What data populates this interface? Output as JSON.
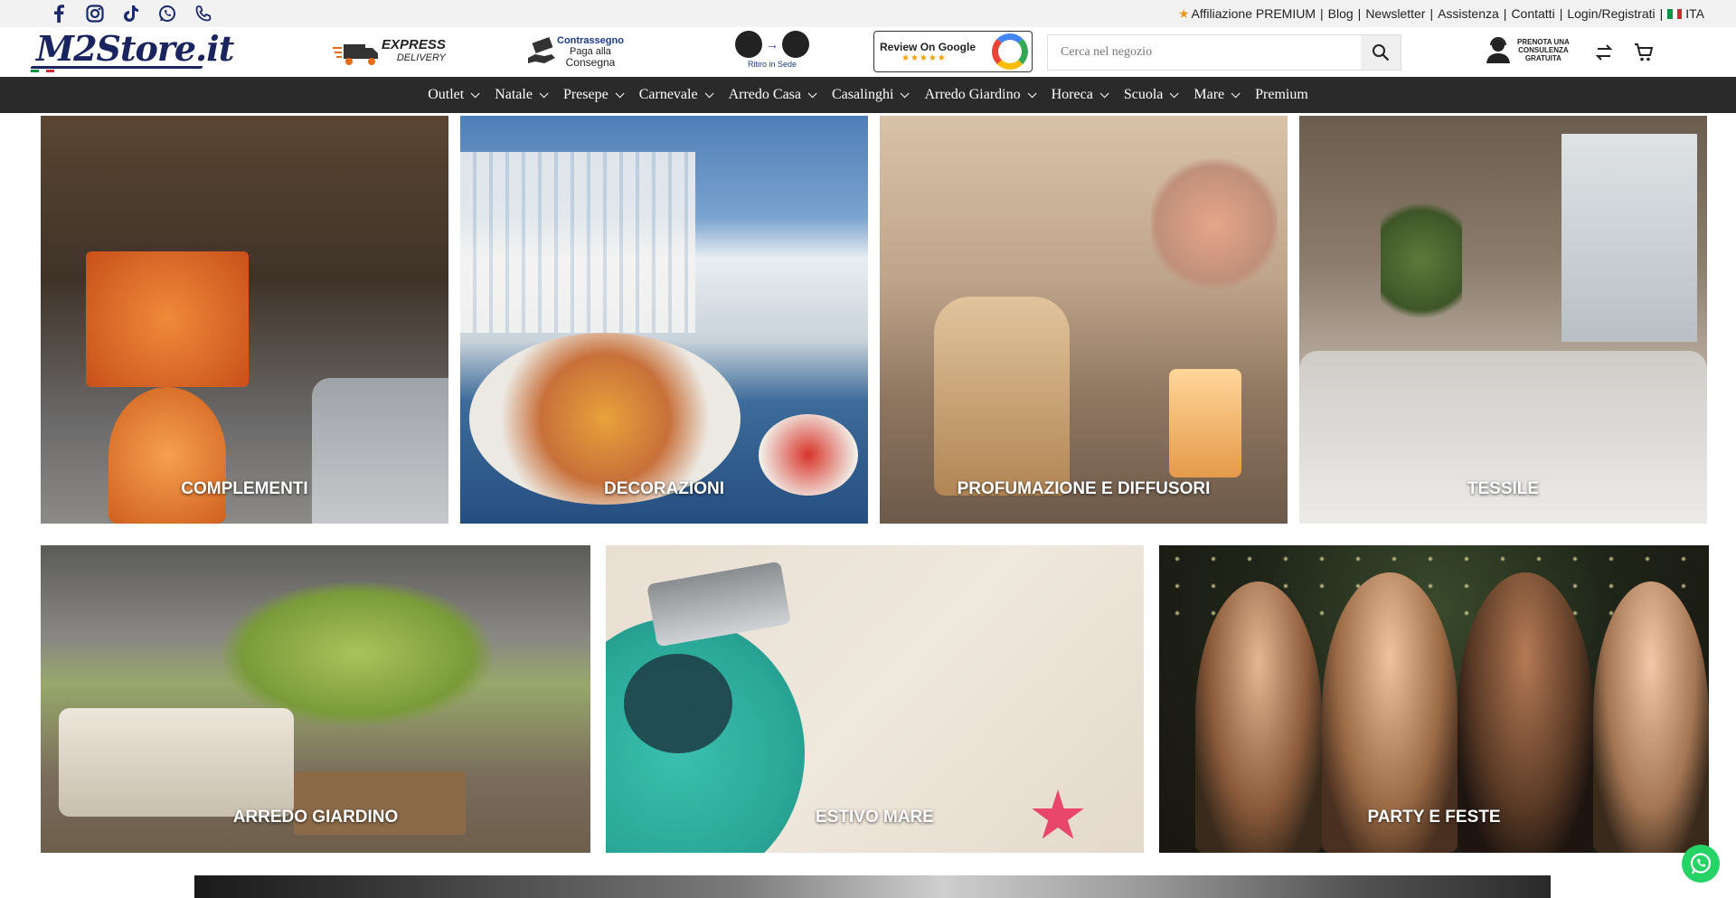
{
  "topbar": {
    "social": [
      "facebook-icon",
      "instagram-icon",
      "tiktok-icon",
      "whatsapp-icon",
      "phone-icon"
    ],
    "links": [
      "Affiliazione PREMIUM",
      "Blog",
      "Newsletter",
      "Assistenza",
      "Contatti",
      "Login/Registrati"
    ],
    "language": "ITA"
  },
  "header": {
    "logo": "M2Store.it",
    "express": {
      "title": "EXPRESS",
      "sub": "DELIVERY"
    },
    "contrassegno": {
      "title": "Contrassegno",
      "line1": "Paga alla",
      "line2": "Consegna"
    },
    "ritiro": "Ritiro in Sede",
    "review": {
      "title": "Review On Google",
      "stars": "★★★★★"
    },
    "search_placeholder": "Cerca nel negozio",
    "consulenza": {
      "l1": "PRENOTA UNA",
      "l2": "CONSULENZA",
      "l3": "GRATUITA"
    }
  },
  "nav": {
    "items": [
      {
        "label": "Outlet",
        "dropdown": true
      },
      {
        "label": "Natale",
        "dropdown": true
      },
      {
        "label": "Presepe",
        "dropdown": true
      },
      {
        "label": "Carnevale",
        "dropdown": true
      },
      {
        "label": "Arredo Casa",
        "dropdown": true
      },
      {
        "label": "Casalinghi",
        "dropdown": true
      },
      {
        "label": "Arredo Giardino",
        "dropdown": true
      },
      {
        "label": "Horeca",
        "dropdown": true
      },
      {
        "label": "Scuola",
        "dropdown": true
      },
      {
        "label": "Mare",
        "dropdown": true
      },
      {
        "label": "Premium",
        "dropdown": false
      }
    ]
  },
  "tiles": {
    "row1": [
      "COMPLEMENTI",
      "DECORAZIONI",
      "PROFUMAZIONE E DIFFUSORI",
      "TESSILE"
    ],
    "row2": [
      "ARREDO GIARDINO",
      "ESTIVO MARE",
      "PARTY E FESTE"
    ]
  },
  "colors": {
    "nav_bg": "#2a2a2a",
    "brand": "#1a2560",
    "whatsapp": "#25d366"
  }
}
